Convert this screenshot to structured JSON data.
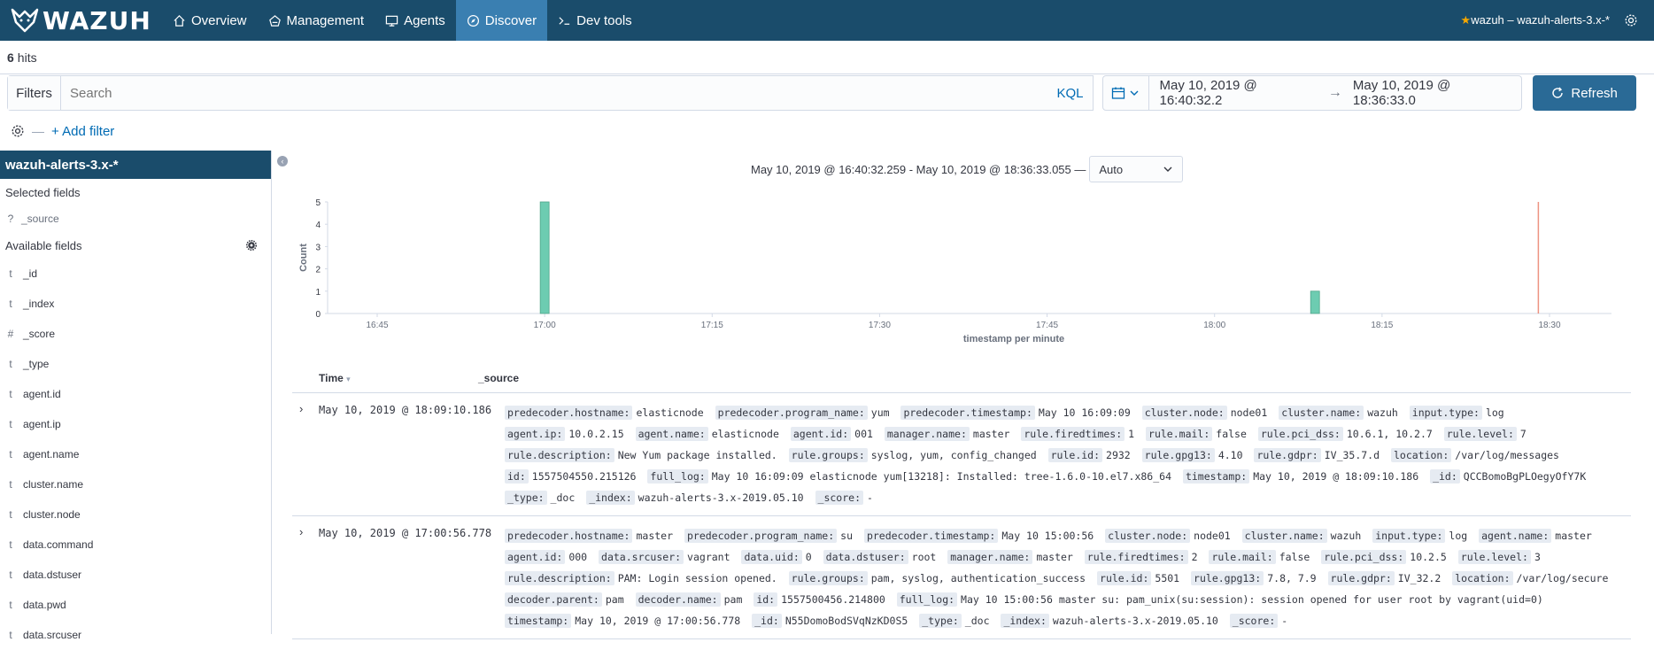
{
  "nav": {
    "logo": "WAZUH",
    "items": [
      {
        "label": "Overview",
        "icon": "home-icon",
        "active": false
      },
      {
        "label": "Management",
        "icon": "management-icon",
        "active": false
      },
      {
        "label": "Agents",
        "icon": "monitor-icon",
        "active": false
      },
      {
        "label": "Discover",
        "icon": "compass-icon",
        "active": true
      },
      {
        "label": "Dev tools",
        "icon": "console-icon",
        "active": false
      }
    ],
    "api_label": "wazuh – wazuh-alerts-3.x-*"
  },
  "hits": {
    "count": "6",
    "label": "hits"
  },
  "query": {
    "filters_label": "Filters",
    "search_placeholder": "Search",
    "kql_label": "KQL",
    "date_from": "May 10, 2019 @ 16:40:32.2",
    "date_to": "May 10, 2019 @ 18:36:33.0",
    "arrow": "→",
    "refresh_label": "Refresh",
    "add_filter_label": "+ Add filter",
    "sep": "—"
  },
  "sidebar": {
    "index_pattern": "wazuh-alerts-3.x-*",
    "selected_title": "Selected fields",
    "selected_fields": [
      {
        "type": "?",
        "name": "_source"
      }
    ],
    "available_title": "Available fields",
    "available_fields": [
      {
        "type": "t",
        "name": "_id"
      },
      {
        "type": "t",
        "name": "_index"
      },
      {
        "type": "#",
        "name": "_score"
      },
      {
        "type": "t",
        "name": "_type"
      },
      {
        "type": "t",
        "name": "agent.id"
      },
      {
        "type": "t",
        "name": "agent.ip"
      },
      {
        "type": "t",
        "name": "agent.name"
      },
      {
        "type": "t",
        "name": "cluster.name"
      },
      {
        "type": "t",
        "name": "cluster.node"
      },
      {
        "type": "t",
        "name": "data.command"
      },
      {
        "type": "t",
        "name": "data.dstuser"
      },
      {
        "type": "t",
        "name": "data.pwd"
      },
      {
        "type": "t",
        "name": "data.srcuser"
      }
    ]
  },
  "histogram": {
    "range_label": "May 10, 2019 @ 16:40:32.259 - May 10, 2019 @ 18:36:33.055 —",
    "interval": "Auto"
  },
  "chart_data": {
    "type": "bar",
    "x_ticks": [
      "16:45",
      "17:00",
      "17:15",
      "17:30",
      "17:45",
      "18:00",
      "18:15",
      "18:30"
    ],
    "y_ticks": [
      "0",
      "1",
      "2",
      "3",
      "4",
      "5"
    ],
    "xlabel": "timestamp per minute",
    "ylabel": "Count",
    "ylim": [
      0,
      5
    ],
    "bars": [
      {
        "time": "17:00",
        "value": 5
      },
      {
        "time": "18:09",
        "value": 1
      }
    ],
    "now_marker": "18:29",
    "bar_color": "#6dccb1",
    "marker_color": "#e7664c"
  },
  "table": {
    "col_time": "Time",
    "col_source": "_source",
    "rows": [
      {
        "time": "May 10, 2019 @ 18:09:10.186",
        "fields": [
          [
            "predecoder.hostname:",
            "elasticnode"
          ],
          [
            "predecoder.program_name:",
            "yum"
          ],
          [
            "predecoder.timestamp:",
            "May 10 16:09:09"
          ],
          [
            "cluster.node:",
            "node01"
          ],
          [
            "cluster.name:",
            "wazuh"
          ],
          [
            "input.type:",
            "log"
          ],
          [
            "agent.ip:",
            "10.0.2.15"
          ],
          [
            "agent.name:",
            "elasticnode"
          ],
          [
            "agent.id:",
            "001"
          ],
          [
            "manager.name:",
            "master"
          ],
          [
            "rule.firedtimes:",
            "1"
          ],
          [
            "rule.mail:",
            "false"
          ],
          [
            "rule.pci_dss:",
            "10.6.1, 10.2.7"
          ],
          [
            "rule.level:",
            "7"
          ],
          [
            "rule.description:",
            "New Yum package installed."
          ],
          [
            "rule.groups:",
            "syslog, yum, config_changed"
          ],
          [
            "rule.id:",
            "2932"
          ],
          [
            "rule.gpg13:",
            "4.10"
          ],
          [
            "rule.gdpr:",
            "IV_35.7.d"
          ],
          [
            "location:",
            "/var/log/messages"
          ],
          [
            "id:",
            "1557504550.215126"
          ],
          [
            "full_log:",
            "May 10 16:09:09 elasticnode yum[13218]: Installed: tree-1.6.0-10.el7.x86_64"
          ],
          [
            "timestamp:",
            "May 10, 2019 @ 18:09:10.186"
          ],
          [
            "_id:",
            "QCCBomoBgPLOegyOfY7K"
          ],
          [
            "_type:",
            "_doc"
          ],
          [
            "_index:",
            "wazuh-alerts-3.x-2019.05.10"
          ],
          [
            "_score:",
            "-"
          ]
        ]
      },
      {
        "time": "May 10, 2019 @ 17:00:56.778",
        "fields": [
          [
            "predecoder.hostname:",
            "master"
          ],
          [
            "predecoder.program_name:",
            "su"
          ],
          [
            "predecoder.timestamp:",
            "May 10 15:00:56"
          ],
          [
            "cluster.node:",
            "node01"
          ],
          [
            "cluster.name:",
            "wazuh"
          ],
          [
            "input.type:",
            "log"
          ],
          [
            "agent.name:",
            "master"
          ],
          [
            "agent.id:",
            "000"
          ],
          [
            "data.srcuser:",
            "vagrant"
          ],
          [
            "data.uid:",
            "0"
          ],
          [
            "data.dstuser:",
            "root"
          ],
          [
            "manager.name:",
            "master"
          ],
          [
            "rule.firedtimes:",
            "2"
          ],
          [
            "rule.mail:",
            "false"
          ],
          [
            "rule.pci_dss:",
            "10.2.5"
          ],
          [
            "rule.level:",
            "3"
          ],
          [
            "rule.description:",
            "PAM: Login session opened."
          ],
          [
            "rule.groups:",
            "pam, syslog, authentication_success"
          ],
          [
            "rule.id:",
            "5501"
          ],
          [
            "rule.gpg13:",
            "7.8, 7.9"
          ],
          [
            "rule.gdpr:",
            "IV_32.2"
          ],
          [
            "location:",
            "/var/log/secure"
          ],
          [
            "decoder.parent:",
            "pam"
          ],
          [
            "decoder.name:",
            "pam"
          ],
          [
            "id:",
            "1557500456.214800"
          ],
          [
            "full_log:",
            "May 10 15:00:56 master su: pam_unix(su:session): session opened for user root by vagrant(uid=0)"
          ],
          [
            "timestamp:",
            "May 10, 2019 @ 17:00:56.778"
          ],
          [
            "_id:",
            "N55DomoBodSVqNzKD0S5"
          ],
          [
            "_type:",
            "_doc"
          ],
          [
            "_index:",
            "wazuh-alerts-3.x-2019.05.10"
          ],
          [
            "_score:",
            "-"
          ]
        ]
      }
    ]
  }
}
